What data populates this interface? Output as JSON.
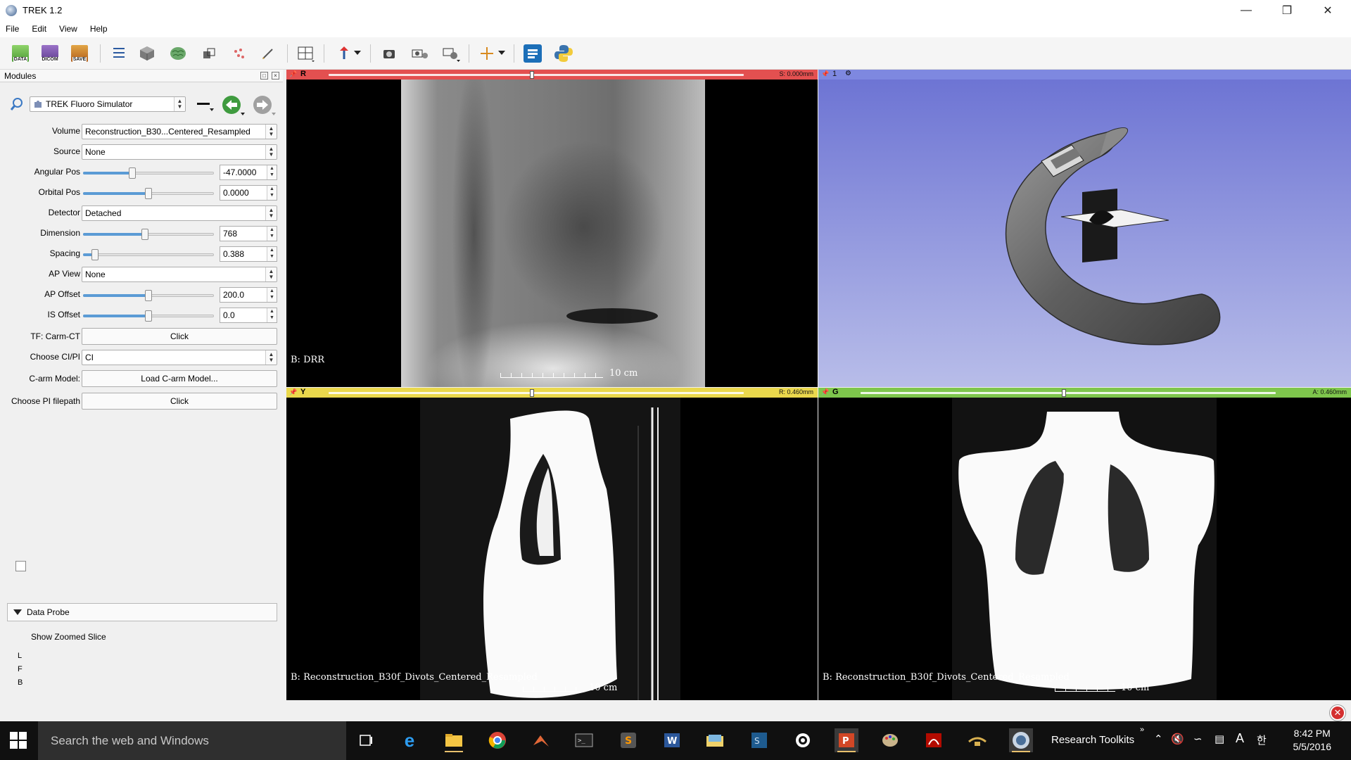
{
  "app": {
    "title": "TREK 1.2"
  },
  "menu": [
    "File",
    "Edit",
    "View",
    "Help"
  ],
  "toolbar": {
    "data_label": "DATA",
    "dicom_label": "DICOM",
    "save_label": "SAVE"
  },
  "modules": {
    "header": "Modules",
    "selected_module": "TREK Fluoro Simulator"
  },
  "params": {
    "volume": {
      "label": "Volume",
      "value": "Reconstruction_B30...Centered_Resampled"
    },
    "source": {
      "label": "Source",
      "value": "None"
    },
    "angular_pos": {
      "label": "Angular Pos",
      "value": "-47.0000",
      "level": 0.37
    },
    "orbital_pos": {
      "label": "Orbital Pos",
      "value": "0.0000",
      "level": 0.5
    },
    "detector": {
      "label": "Detector",
      "value": "Detached"
    },
    "dimension": {
      "label": "Dimension",
      "value": "768",
      "level": 0.47
    },
    "spacing": {
      "label": "Spacing",
      "value": "0.388",
      "level": 0.07
    },
    "ap_view": {
      "label": "AP View",
      "value": "None"
    },
    "ap_offset": {
      "label": "AP Offset",
      "value": "200.0",
      "level": 0.5
    },
    "is_offset": {
      "label": "IS Offset",
      "value": "0.0",
      "level": 0.5
    },
    "tf_carm_ct": {
      "label": "TF: Carm-CT",
      "button": "Click"
    },
    "choose_ci_pi": {
      "label": "Choose CI/PI",
      "value": "CI"
    },
    "carm_model": {
      "label": "C-arm Model:",
      "button": "Load C-arm Model..."
    },
    "pi_filepath": {
      "label": "Choose PI filepath",
      "button": "Click"
    }
  },
  "data_probe": {
    "title": "Data Probe",
    "zoom_label": "Show Zoomed Slice",
    "zoom_checked": false,
    "lines": [
      "L",
      "F",
      "B"
    ]
  },
  "views": {
    "red": {
      "letter": "R",
      "position": "S: 0.000mm",
      "slider": 0.49,
      "overlay": "B: DRR",
      "scale": "10 cm",
      "color": "#e35050"
    },
    "threed": {
      "label": "1",
      "color": "#7e88e0"
    },
    "yellow": {
      "letter": "Y",
      "position": "R: 0.460mm",
      "slider": 0.49,
      "overlay": "B: Reconstruction_B30f_Divots_Centered_Resampled",
      "scale": "10 cm",
      "color": "#ead84c"
    },
    "green": {
      "letter": "G",
      "position": "A: 0.460mm",
      "slider": 0.49,
      "overlay": "B: Reconstruction_B30f_Divots_Centered_Resampled",
      "scale": "10 cm",
      "color": "#7ec64c"
    }
  },
  "taskbar": {
    "search_placeholder": "Search the web and Windows",
    "tray_label": "Research Toolkits",
    "time": "8:42 PM",
    "date": "5/5/2016"
  }
}
